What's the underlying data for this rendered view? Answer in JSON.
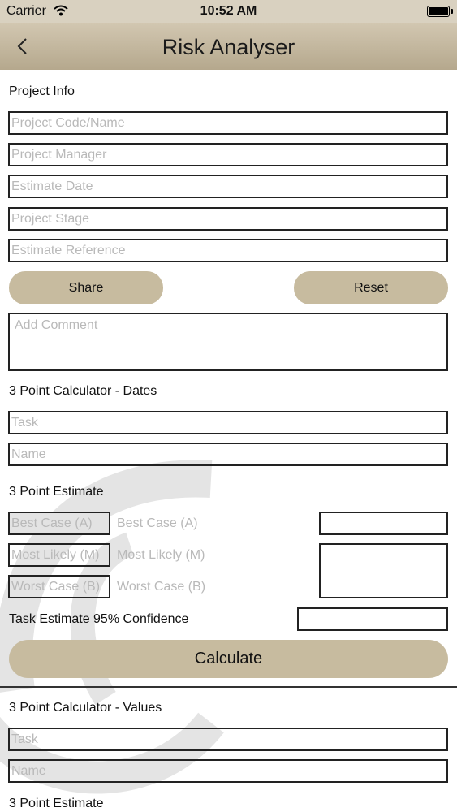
{
  "status_bar": {
    "carrier": "Carrier",
    "time": "10:52 AM"
  },
  "nav": {
    "title": "Risk Analyser"
  },
  "project_info": {
    "heading": "Project Info",
    "fields": {
      "code": "Project Code/Name",
      "manager": "Project Manager",
      "date": "Estimate Date",
      "stage": "Project Stage",
      "reference": "Estimate Reference"
    },
    "share_label": "Share",
    "reset_label": "Reset",
    "comment_placeholder": "Add Comment"
  },
  "dates_calculator": {
    "heading": "3 Point Calculator - Dates",
    "task_placeholder": "Task",
    "name_placeholder": "Name",
    "estimate_heading": "3 Point Estimate",
    "best_case": "Best Case (A)",
    "most_likely": "Most Likely (M)",
    "worst_case": "Worst Case (B)",
    "confidence_label": "Task Estimate 95% Confidence",
    "calculate_label": "Calculate"
  },
  "values_calculator": {
    "heading": "3 Point Calculator - Values",
    "task_placeholder": "Task",
    "name_placeholder": "Name",
    "estimate_heading": "3 Point Estimate"
  },
  "colors": {
    "nav_accent": "#bfb398",
    "button": "#c7bb9f",
    "placeholder": "#b9b9b9"
  }
}
